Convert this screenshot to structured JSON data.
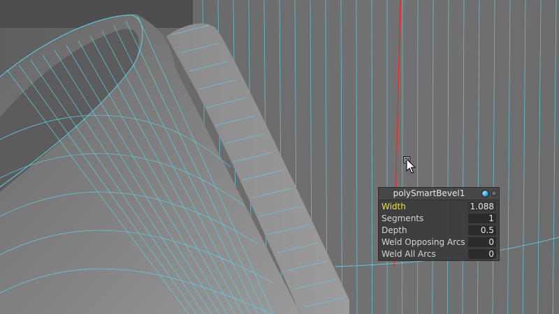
{
  "viewport": {
    "background": "#6e6e6e",
    "wire_color": "#5fd0e6",
    "selection_edge_color": "#ff2020"
  },
  "cursor": {
    "icon": "arrow-cursor-icon",
    "badge_icon": "square-selection-icon"
  },
  "hud": {
    "title": "polySmartBevel1",
    "header_icons": [
      "globe-icon",
      "pin-icon"
    ],
    "attributes": [
      {
        "label": "Width",
        "value": "1.088",
        "active": true
      },
      {
        "label": "Segments",
        "value": "1",
        "active": false
      },
      {
        "label": "Depth",
        "value": "0.5",
        "active": false
      },
      {
        "label": "Weld Opposing Arcs",
        "value": "0",
        "active": false
      },
      {
        "label": "Weld All Arcs",
        "value": "0",
        "active": false
      }
    ],
    "active_color": "#e8e04a"
  }
}
